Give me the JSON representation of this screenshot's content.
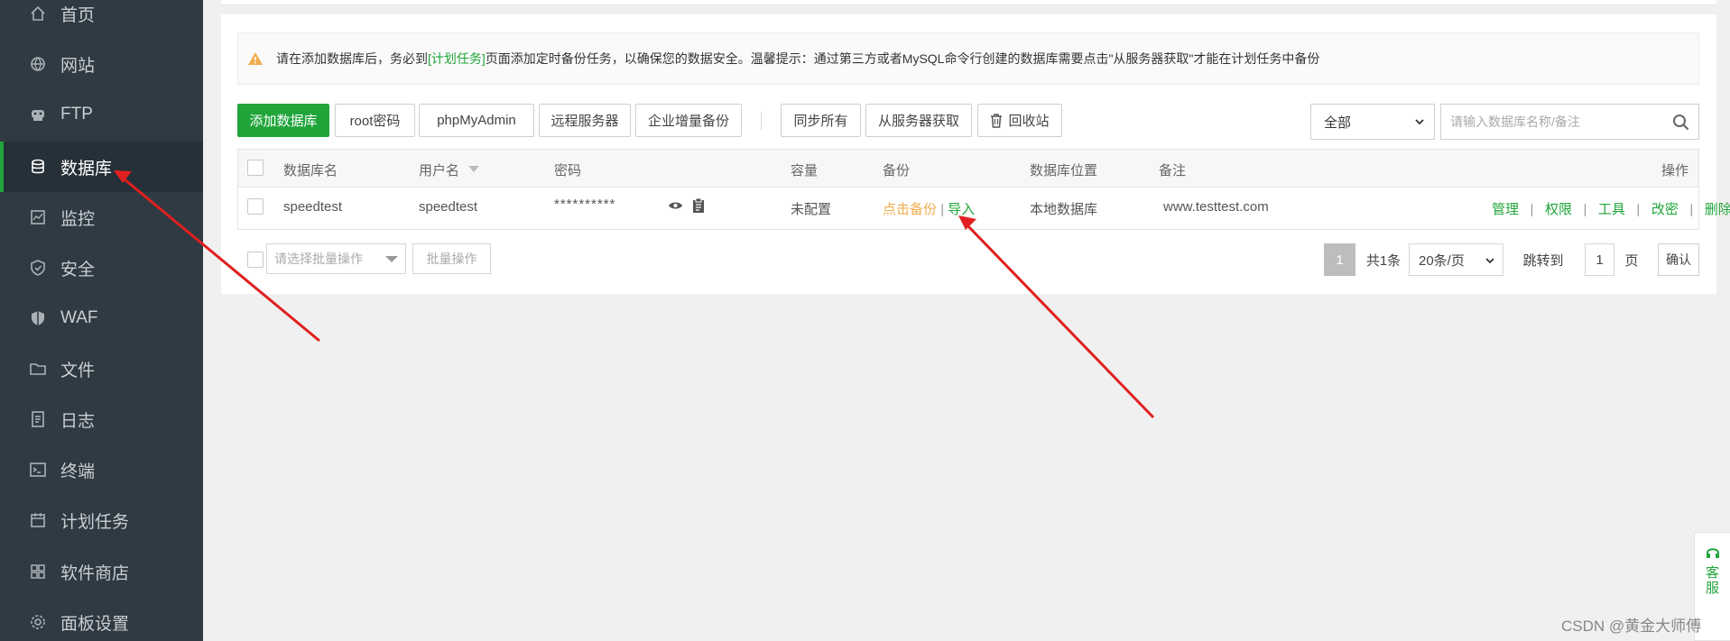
{
  "sidebar": {
    "items": [
      {
        "label": "首页",
        "icon": "home-icon"
      },
      {
        "label": "网站",
        "icon": "globe-icon"
      },
      {
        "label": "FTP",
        "icon": "ftp-icon"
      },
      {
        "label": "数据库",
        "icon": "database-icon",
        "active": true
      },
      {
        "label": "监控",
        "icon": "monitor-icon"
      },
      {
        "label": "安全",
        "icon": "shield-icon"
      },
      {
        "label": "WAF",
        "icon": "waf-shield-icon"
      },
      {
        "label": "文件",
        "icon": "folder-icon"
      },
      {
        "label": "日志",
        "icon": "log-icon"
      },
      {
        "label": "终端",
        "icon": "terminal-icon"
      },
      {
        "label": "计划任务",
        "icon": "calendar-icon"
      },
      {
        "label": "软件商店",
        "icon": "grid-icon"
      },
      {
        "label": "面板设置",
        "icon": "gear-icon"
      }
    ]
  },
  "alert": {
    "part1": "请在添加数据库后，务必到",
    "link": "[计划任务]",
    "part2": "页面添加定时备份任务，以确保您的数据安全。温馨提示：通过第三方或者MySQL命令行创建的数据库需要点击\"从服务器获取\"才能在计划任务中备份"
  },
  "toolbar": {
    "add_db": "添加数据库",
    "root_pw": "root密码",
    "phpmyadmin": "phpMyAdmin",
    "remote": "远程服务器",
    "enterprise_backup": "企业增量备份",
    "sync_all": "同步所有",
    "fetch_server": "从服务器获取",
    "recycle": "回收站",
    "filter_value": "全部",
    "search_placeholder": "请输入数据库名称/备注"
  },
  "table": {
    "headers": {
      "name": "数据库名",
      "user": "用户名",
      "password": "密码",
      "capacity": "容量",
      "backup": "备份",
      "location": "数据库位置",
      "note": "备注",
      "ops": "操作"
    },
    "rows": [
      {
        "name": "speedtest",
        "user": "speedtest",
        "password": "**********",
        "capacity": "未配置",
        "backup": "点击备份",
        "import": "导入",
        "location": "本地数据库",
        "note": "www.testtest.com",
        "ops": [
          "管理",
          "权限",
          "工具",
          "改密",
          "删除"
        ]
      }
    ]
  },
  "batch": {
    "select_placeholder": "请选择批量操作",
    "button": "批量操作"
  },
  "pagination": {
    "current": "1",
    "total": "共1条",
    "per_page": "20条/页",
    "goto_label": "跳转到",
    "goto_value": "1",
    "page_unit": "页",
    "confirm": "确认"
  },
  "kefu": {
    "line1": "客",
    "line2": "服"
  },
  "watermark": "CSDN @黄金大师傅",
  "colors": {
    "accent": "#20a53a",
    "sidebar": "#2f3a42",
    "warning": "#f0ad4e",
    "arrow": "#e02020"
  }
}
